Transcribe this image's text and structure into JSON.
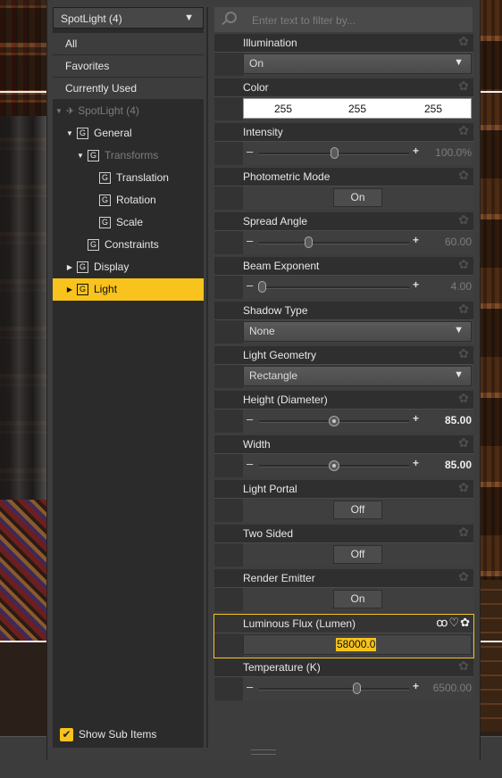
{
  "node_selector": {
    "label": "SpotLight (4)"
  },
  "tree": {
    "items": [
      {
        "label": "All"
      },
      {
        "label": "Favorites"
      },
      {
        "label": "Currently Used"
      },
      {
        "label": "SpotLight (4)"
      },
      {
        "label": "General"
      },
      {
        "label": "Transforms"
      },
      {
        "label": "Translation"
      },
      {
        "label": "Rotation"
      },
      {
        "label": "Scale"
      },
      {
        "label": "Constraints"
      },
      {
        "label": "Display"
      },
      {
        "label": "Light"
      }
    ],
    "group_glyph": "G",
    "show_sub_items": {
      "label": "Show Sub Items",
      "checked": true
    }
  },
  "filter": {
    "placeholder": "Enter text to filter by..."
  },
  "properties": [
    {
      "name": "Illumination",
      "type": "dropdown",
      "value": "On"
    },
    {
      "name": "Color",
      "type": "color",
      "r": "255",
      "g": "255",
      "b": "255"
    },
    {
      "name": "Intensity",
      "type": "slider",
      "value": "100.0%",
      "fraction": 0.5
    },
    {
      "name": "Photometric Mode",
      "type": "toggle",
      "value": "On"
    },
    {
      "name": "Spread Angle",
      "type": "slider",
      "value": "60.00",
      "fraction": 0.33
    },
    {
      "name": "Beam Exponent",
      "type": "slider",
      "value": "4.00",
      "fraction": 0.02
    },
    {
      "name": "Shadow Type",
      "type": "dropdown",
      "value": "None"
    },
    {
      "name": "Light Geometry",
      "type": "dropdown",
      "value": "Rectangle"
    },
    {
      "name": "Height (Diameter)",
      "type": "slider",
      "value": "85.00",
      "fraction": 0.5
    },
    {
      "name": "Width",
      "type": "slider",
      "value": "85.00",
      "fraction": 0.5
    },
    {
      "name": "Light Portal",
      "type": "toggle",
      "value": "Off"
    },
    {
      "name": "Two Sided",
      "type": "toggle",
      "value": "Off"
    },
    {
      "name": "Render Emitter",
      "type": "toggle",
      "value": "On"
    },
    {
      "name": "Luminous Flux (Lumen)",
      "type": "number",
      "value": "58000.0"
    },
    {
      "name": "Temperature (K)",
      "type": "slider",
      "value": "6500.00",
      "fraction": 0.65
    }
  ],
  "colors": {
    "accent": "#f7c31c",
    "panel": "#3d3d3d",
    "header": "#2f2f2f"
  }
}
